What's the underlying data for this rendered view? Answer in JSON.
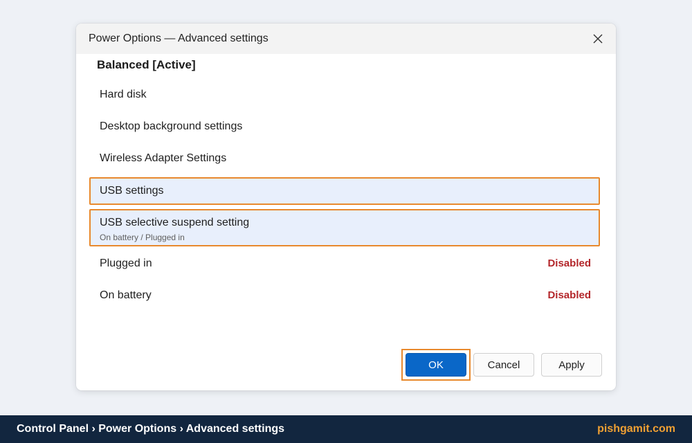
{
  "dialog": {
    "title": "Power Options — Advanced settings",
    "plan_heading": "Balanced [Active]",
    "rows": {
      "hard_disk": "Hard disk",
      "desktop_background": "Desktop background settings",
      "wireless_adapter": "Wireless Adapter Settings",
      "usb_settings": "USB settings",
      "usb_selective_suspend": "USB selective suspend setting",
      "usb_selective_suspend_sub": "On battery / Plugged in",
      "plugged_in": {
        "label": "Plugged in",
        "value": "Disabled"
      },
      "on_battery": {
        "label": "On battery",
        "value": "Disabled"
      }
    },
    "buttons": {
      "ok": "OK",
      "cancel": "Cancel",
      "apply": "Apply"
    }
  },
  "footer": {
    "breadcrumb": "Control Panel › Power Options › Advanced settings",
    "brand": "pishgamit.com"
  },
  "colors": {
    "accent_blue": "#0a67c8",
    "highlight_orange": "#e8892d",
    "disabled_red": "#b3262a",
    "footer_bg": "#12263f",
    "brand_orange": "#f0a033"
  },
  "icons": {
    "close": "close-icon"
  }
}
